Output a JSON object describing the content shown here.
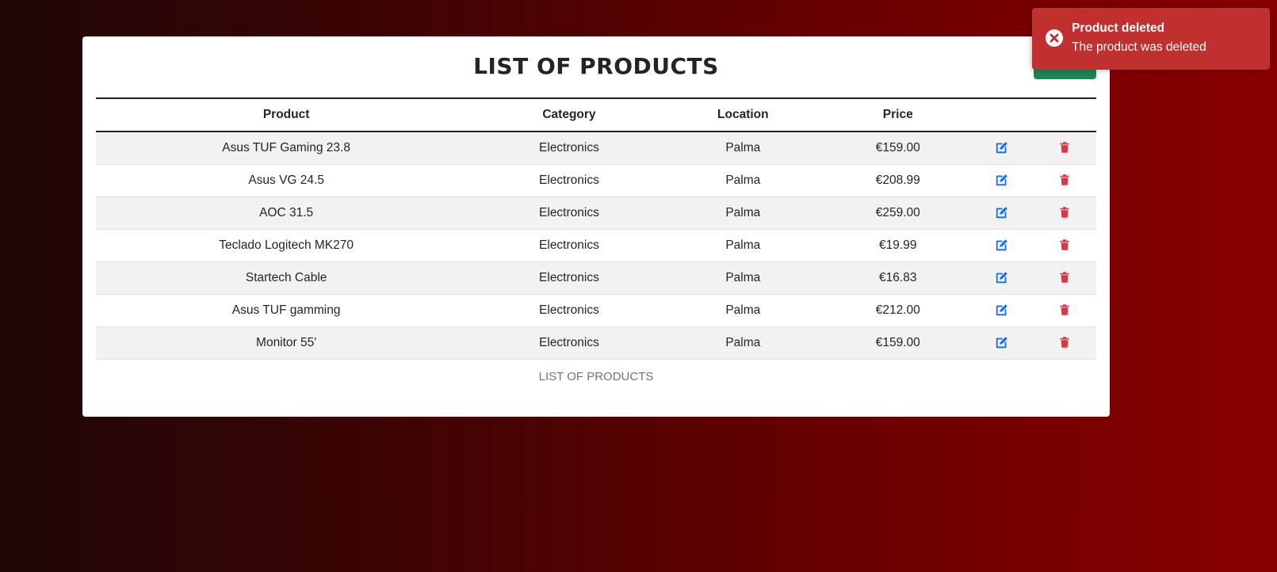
{
  "page": {
    "title": "LIST OF PRODUCTS",
    "caption": "LIST OF PRODUCTS"
  },
  "table": {
    "headers": {
      "product": "Product",
      "category": "Category",
      "location": "Location",
      "price": "Price"
    },
    "rows": [
      {
        "product": "Asus TUF Gaming 23.8",
        "category": "Electronics",
        "location": "Palma",
        "price": "€159.00"
      },
      {
        "product": "Asus VG 24.5",
        "category": "Electronics",
        "location": "Palma",
        "price": "€208.99"
      },
      {
        "product": "AOC 31.5",
        "category": "Electronics",
        "location": "Palma",
        "price": "€259.00"
      },
      {
        "product": "Teclado Logitech MK270",
        "category": "Electronics",
        "location": "Palma",
        "price": "€19.99"
      },
      {
        "product": "Startech Cable",
        "category": "Electronics",
        "location": "Palma",
        "price": "€16.83"
      },
      {
        "product": "Asus TUF gamming",
        "category": "Electronics",
        "location": "Palma",
        "price": "€212.00"
      },
      {
        "product": "Monitor 55'",
        "category": "Electronics",
        "location": "Palma",
        "price": "€159.00"
      }
    ],
    "row_actions": {
      "edit_icon": "edit-icon",
      "delete_icon": "trash-icon"
    }
  },
  "toast": {
    "title": "Product deleted",
    "message": "The product was deleted",
    "icon": "error-circle-icon"
  },
  "colors": {
    "background_gradient_start": "#1f0707",
    "background_gradient_end": "#8a0000",
    "toast_background": "#c0302e",
    "add_button": "#198754",
    "edit_icon": "#0d6efd",
    "delete_icon": "#dc3545"
  }
}
